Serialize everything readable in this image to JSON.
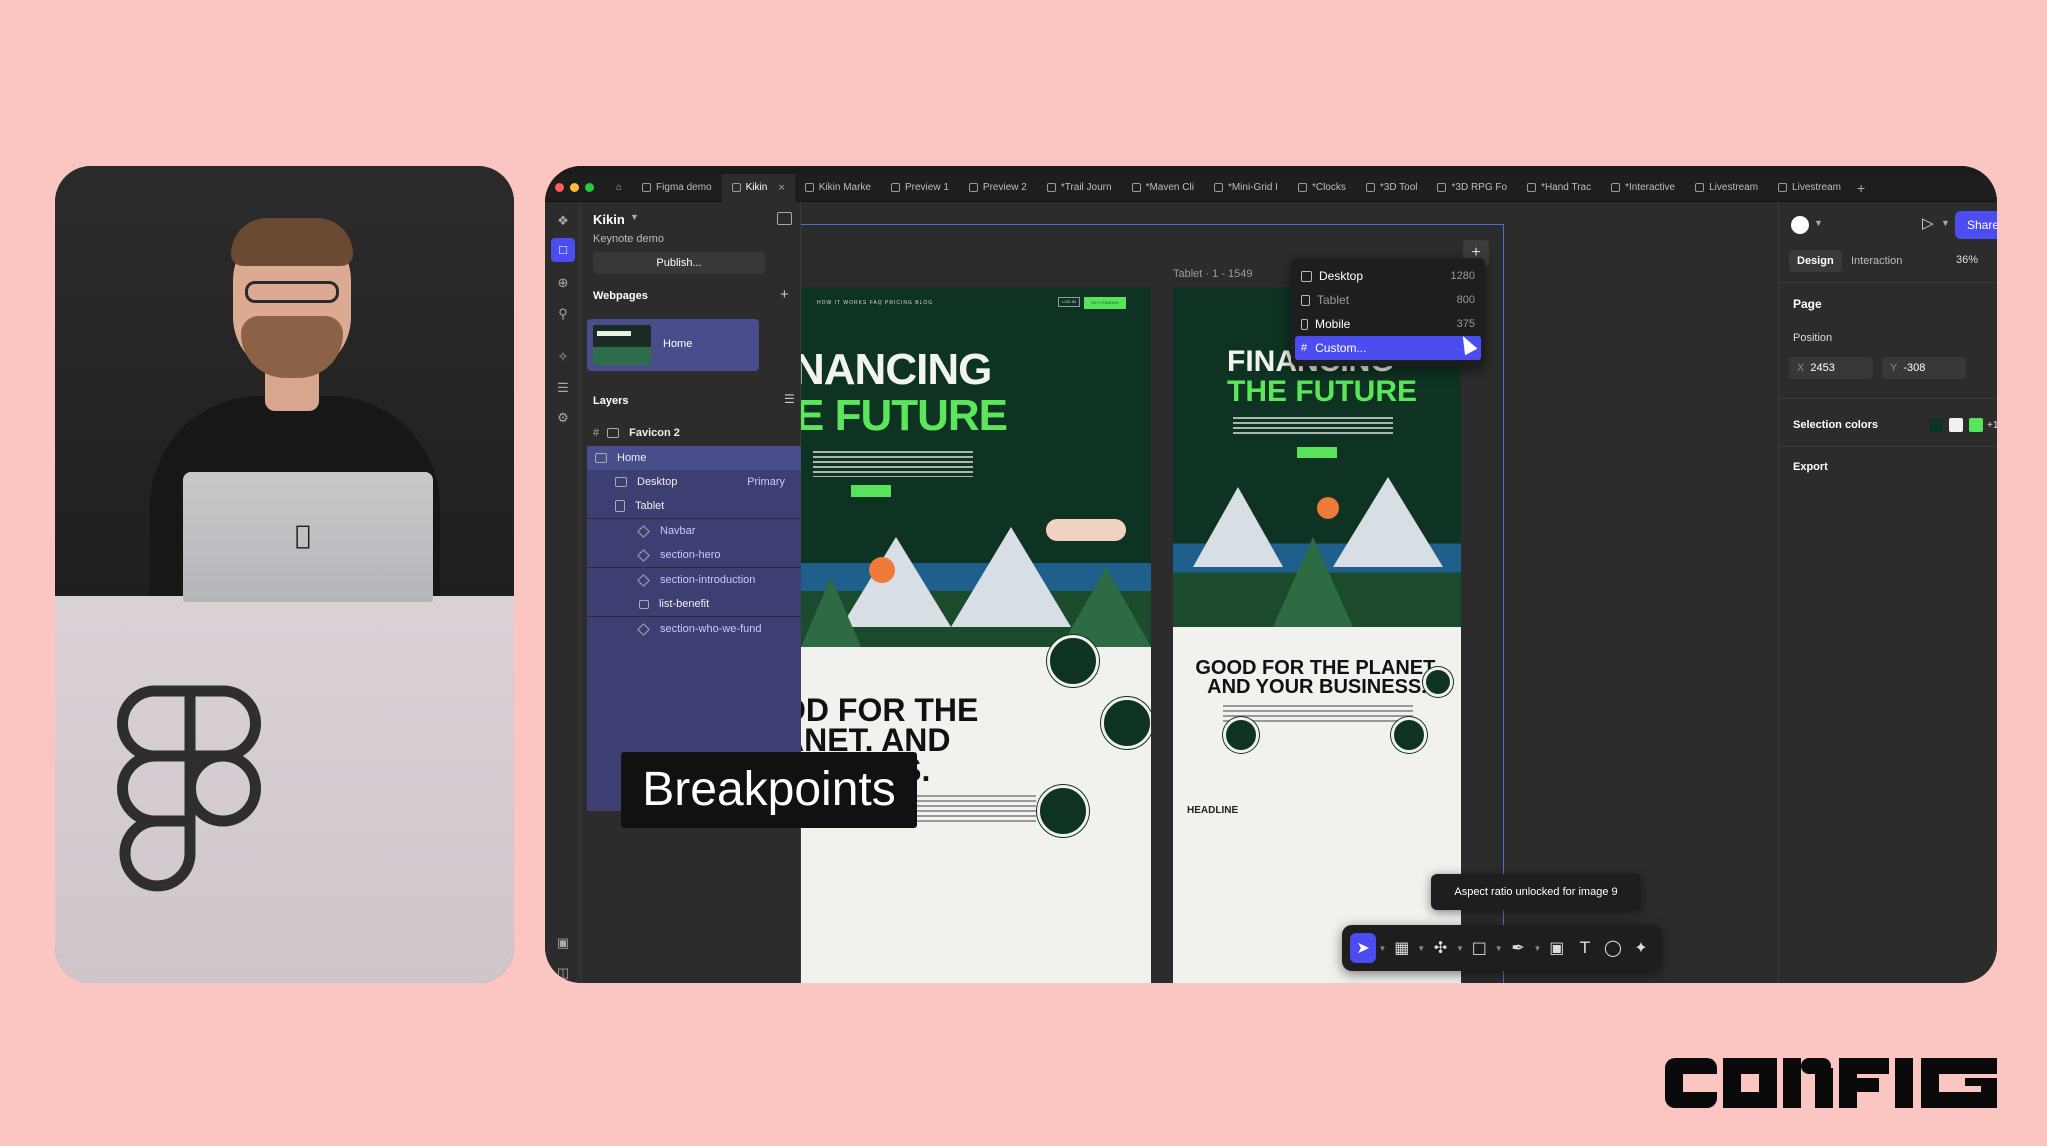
{
  "figma_file": {
    "name": "Kikin",
    "subtitle": "Keynote demo",
    "publish_label": "Publish...",
    "tabs": [
      {
        "label": "Figma demo",
        "active": false
      },
      {
        "label": "Kikin",
        "active": true
      },
      {
        "label": "Kikin Marke",
        "active": false
      },
      {
        "label": "Preview 1",
        "active": false
      },
      {
        "label": "Preview 2",
        "active": false
      },
      {
        "label": "*Trail Journ",
        "active": false
      },
      {
        "label": "*Maven Cli",
        "active": false
      },
      {
        "label": "*Mini-Grid I",
        "active": false
      },
      {
        "label": "*Clocks",
        "active": false
      },
      {
        "label": "*3D Tool",
        "active": false
      },
      {
        "label": "*3D RPG Fo",
        "active": false
      },
      {
        "label": "*Hand Trac",
        "active": false
      },
      {
        "label": "*Interactive",
        "active": false
      },
      {
        "label": "Livestream",
        "active": false
      },
      {
        "label": "Livestream",
        "active": false
      }
    ]
  },
  "left_panel": {
    "webpages_heading": "Webpages",
    "webpage_item": "Home",
    "layers_heading": "Layers",
    "layers": [
      {
        "label": "Favicon 2",
        "level": 0,
        "state": "normal"
      },
      {
        "label": "Home",
        "level": 0,
        "state": "selected"
      },
      {
        "label": "Desktop",
        "level": 1,
        "state": "child",
        "badge": "Primary"
      },
      {
        "label": "Tablet",
        "level": 1,
        "state": "child"
      },
      {
        "label": "Navbar",
        "level": 2,
        "state": "child"
      },
      {
        "label": "section-hero",
        "level": 2,
        "state": "child"
      },
      {
        "label": "section-introduction",
        "level": 2,
        "state": "child"
      },
      {
        "label": "list-benefit",
        "level": 2,
        "state": "child"
      },
      {
        "label": "section-who-we-fund",
        "level": 2,
        "state": "child"
      }
    ]
  },
  "caption": "Breakpoints",
  "canvas": {
    "tablet_frame_label": "Tablet · 1 - 1549",
    "site": {
      "nav_links": "HOW IT WORKS   FAQ   PRICING   BLOG",
      "login": "LOG IN",
      "cta": "GET FUNDING",
      "hero_line1_desktop": "NANCING",
      "hero_line2_desktop": "E FUTURE",
      "hero_line1_tablet": "FINANCING",
      "hero_line2_tablet": "THE FUTURE",
      "planet_desktop": "OD FOR THE\nANET. AND\nUSINESS.",
      "planet_tablet": "GOOD FOR THE PLANET.\nAND YOUR BUSINESS.",
      "headline_tag": "HEADLINE"
    },
    "breakpoint_menu": [
      {
        "label": "Desktop",
        "value": "1280",
        "state": "normal"
      },
      {
        "label": "Tablet",
        "value": "800",
        "state": "dim"
      },
      {
        "label": "Mobile",
        "value": "375",
        "state": "normal"
      },
      {
        "label": "Custom...",
        "value": "",
        "state": "selected"
      }
    ],
    "toast": "Aspect ratio unlocked for image 9",
    "toolbar_icons": [
      "move-tool",
      "frame-tool",
      "component-tool",
      "shape-tool",
      "pen-tool",
      "image-tool",
      "text-tool",
      "comment-tool",
      "ai-tool"
    ]
  },
  "right_panel": {
    "share_label": "Share",
    "tab_design": "Design",
    "tab_interaction": "Interaction",
    "zoom": "36%",
    "page_heading": "Page",
    "position_label": "Position",
    "x_label": "X",
    "x_value": "2453",
    "y_label": "Y",
    "y_value": "-308",
    "selection_colors_label": "Selection colors",
    "selection_colors": [
      "#0f3322",
      "#f1f2ee",
      "#59e35c"
    ],
    "selection_colors_more": "+1",
    "export_label": "Export"
  },
  "branding": {
    "event_logo": "CONFIG"
  },
  "colors": {
    "background": "#fbc6c1",
    "figma_accent": "#4b4df1",
    "site_green": "#59e35c",
    "site_dark": "#0f3322"
  }
}
